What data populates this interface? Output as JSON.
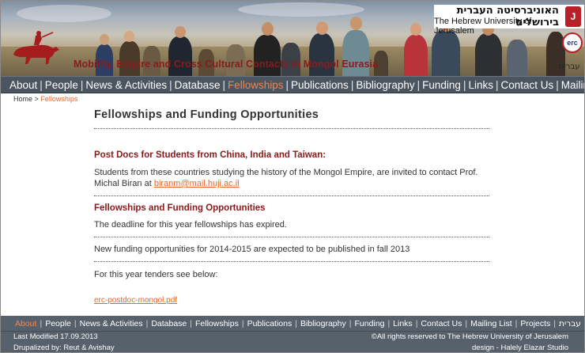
{
  "header": {
    "site_title": "Mobility, Empire and Cross Cultural Contacts in Mongol Eurasia",
    "university_he": "האוניברסיטה העברית בירושלים",
    "university_en": "The Hebrew University of Jerusalem",
    "erc_label": "erc",
    "language_link": "עברית",
    "colors": {
      "title": "#8b1a1a",
      "accent": "#e8652a",
      "nav_bg": "#4a5560"
    }
  },
  "nav": {
    "items": [
      "About",
      "People",
      "News & Activities",
      "Database",
      "Fellowships",
      "Publications",
      "Bibliography",
      "Funding",
      "Links",
      "Contact Us",
      "Mailing List"
    ],
    "active": "Fellowships"
  },
  "breadcrumb": {
    "home": "Home",
    "separator": ">",
    "current": "Fellowships"
  },
  "main": {
    "title": "Fellowships and Funding Opportunities",
    "section1": {
      "heading": "Post Docs for Students from China, India and Taiwan:",
      "text": "Students from these countries studying the history of the Mongol Empire, are invited to contact Prof. Michal Biran at",
      "email": "biranm@mail.huji.ac.il"
    },
    "section2": {
      "heading": "Fellowships and Funding Opportunities",
      "text": "The deadline for this year fellowships has expired."
    },
    "section3": {
      "text": "New funding opportunities for 2014-2015 are expected to be published in fall 2013"
    },
    "section4": {
      "text": "For this year tenders see below:"
    },
    "document_link": "erc-postdoc-mongol.pdf"
  },
  "footer": {
    "nav": {
      "items": [
        "About",
        "People",
        "News & Activities",
        "Database",
        "Fellowships",
        "Publications",
        "Bibliography",
        "Funding",
        "Links",
        "Contact Us",
        "Mailing List",
        "Projects",
        "עברית"
      ],
      "active": "About"
    },
    "last_modified": "Last Modified 17.09.2013",
    "drupalized_by": "Drupalized by: Reut & Avishay",
    "rights": "©All rights reserved to The Hebrew University of Jerusalem",
    "design": "design - Halely Elazar Studio"
  }
}
